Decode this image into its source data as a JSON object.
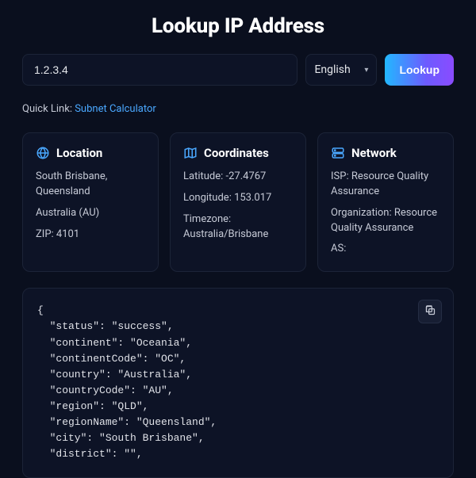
{
  "title": "Lookup IP Address",
  "search": {
    "value": "1.2.3.4",
    "placeholder": "1.2.3.4",
    "language": "English",
    "button": "Lookup"
  },
  "quick_link": {
    "label": "Quick Link:",
    "text": "Subnet Calculator"
  },
  "cards": {
    "location": {
      "title": "Location",
      "city_region": "South Brisbane, Queensland",
      "country": "Australia (AU)",
      "zip": "ZIP: 4101"
    },
    "coordinates": {
      "title": "Coordinates",
      "lat": "Latitude: -27.4767",
      "lon": "Longitude: 153.017",
      "tz": "Timezone: Australia/Brisbane"
    },
    "network": {
      "title": "Network",
      "isp": "ISP: Resource Quality Assurance",
      "org": "Organization: Resource Quality Assurance",
      "as": "AS:"
    }
  },
  "json_response": "{\n  \"status\": \"success\",\n  \"continent\": \"Oceania\",\n  \"continentCode\": \"OC\",\n  \"country\": \"Australia\",\n  \"countryCode\": \"AU\",\n  \"region\": \"QLD\",\n  \"regionName\": \"Queensland\",\n  \"city\": \"South Brisbane\",\n  \"district\": \"\","
}
